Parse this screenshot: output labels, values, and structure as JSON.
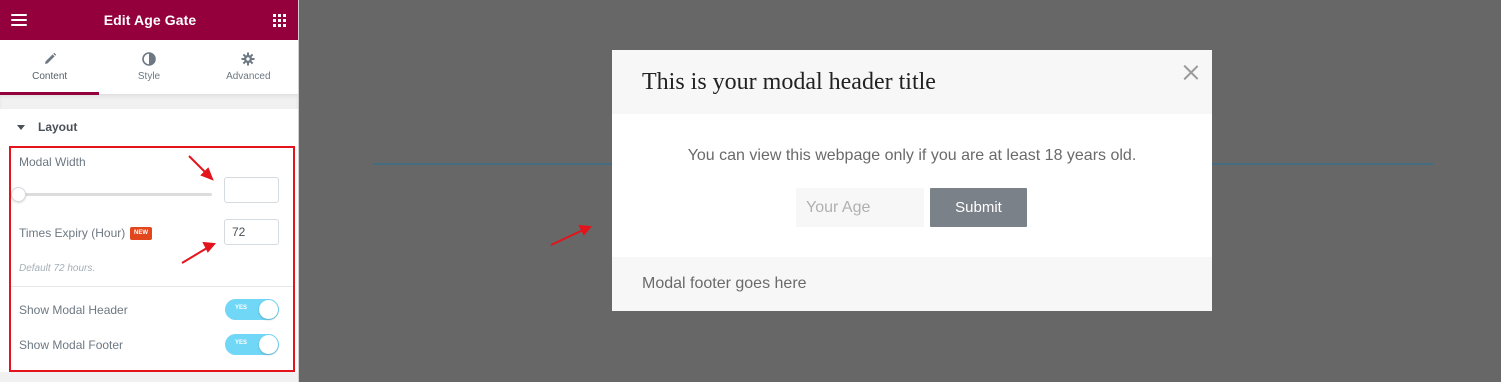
{
  "sidebar": {
    "title": "Edit Age Gate",
    "tabs": [
      {
        "label": "Content",
        "icon": "pencil-icon",
        "active": true
      },
      {
        "label": "Style",
        "icon": "half-circle-icon",
        "active": false
      },
      {
        "label": "Advanced",
        "icon": "gear-icon",
        "active": false
      }
    ],
    "section_title": "Layout",
    "modal_width_label": "Modal Width",
    "modal_width_value": "",
    "times_expiry_label": "Times Expiry (Hour)",
    "new_badge": "NEW",
    "times_expiry_value": "72",
    "times_expiry_desc": "Default 72 hours.",
    "show_header_label": "Show Modal Header",
    "show_footer_label": "Show Modal Footer",
    "toggle_on_text": "YES"
  },
  "modal": {
    "header_title": "This is your modal header title",
    "message": "You can view this webpage only if you are at least 18 years old.",
    "age_placeholder": "Your Age",
    "submit_label": "Submit",
    "footer_text": "Modal footer goes here"
  },
  "colors": {
    "brand": "#93003c",
    "canvas_bg": "#676767",
    "toggle_on": "#71d7f7",
    "annotation_red": "#e3141c"
  }
}
